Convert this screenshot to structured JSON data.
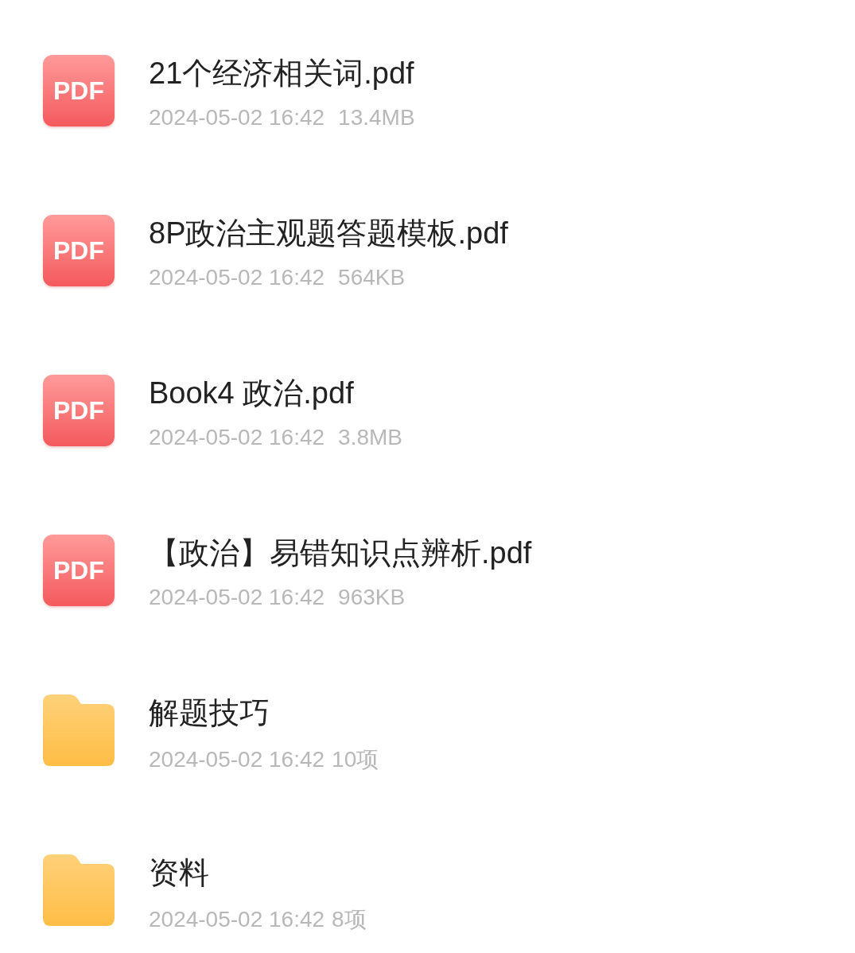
{
  "files": [
    {
      "kind": "pdf",
      "badge": "PDF",
      "name": "21个经济相关词.pdf",
      "date": "2024-05-02 16:42",
      "info": "13.4MB"
    },
    {
      "kind": "pdf",
      "badge": "PDF",
      "name": "8P政治主观题答题模板.pdf",
      "date": "2024-05-02 16:42",
      "info": "564KB"
    },
    {
      "kind": "pdf",
      "badge": "PDF",
      "name": "Book4 政治.pdf",
      "date": "2024-05-02 16:42",
      "info": "3.8MB"
    },
    {
      "kind": "pdf",
      "badge": "PDF",
      "name": "【政治】易错知识点辨析.pdf",
      "date": "2024-05-02 16:42",
      "info": "963KB"
    },
    {
      "kind": "folder",
      "name": "解题技巧",
      "date": "2024-05-02 16:42",
      "info": "10项"
    },
    {
      "kind": "folder",
      "name": "资料",
      "date": "2024-05-02 16:42",
      "info": "8项"
    }
  ]
}
